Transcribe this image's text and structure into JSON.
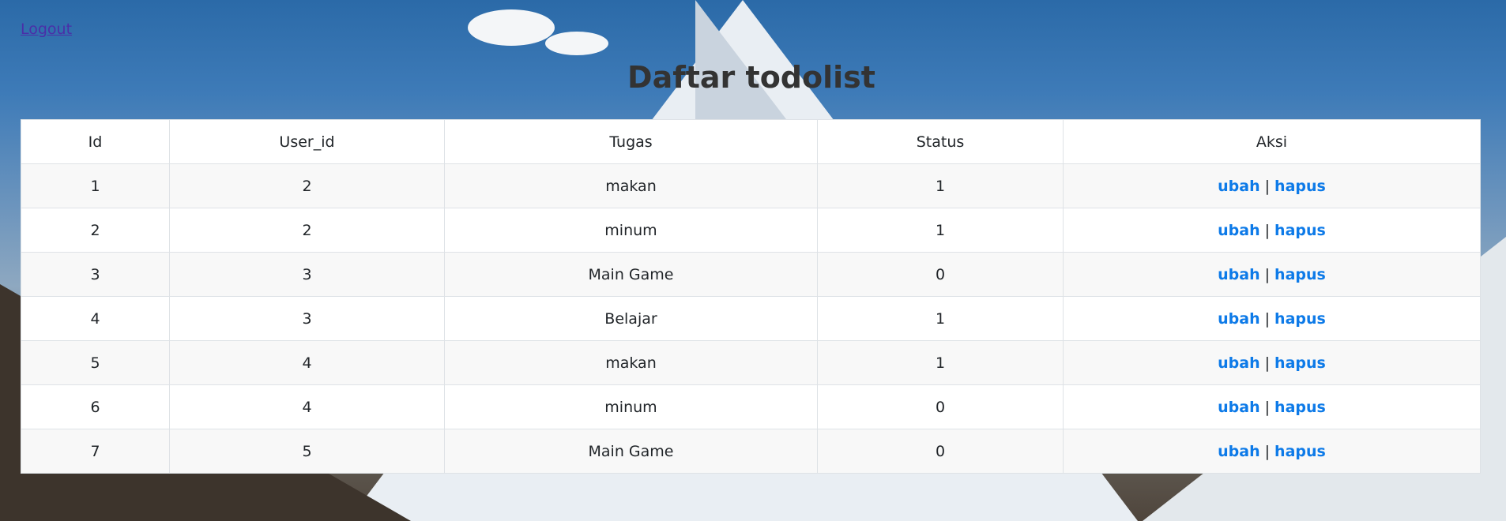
{
  "nav": {
    "logout_label": "Logout"
  },
  "page": {
    "title": "Daftar todolist"
  },
  "table": {
    "headers": [
      "Id",
      "User_id",
      "Tugas",
      "Status",
      "Aksi"
    ],
    "rows": [
      {
        "id": "1",
        "user_id": "2",
        "tugas": "makan",
        "status": "1"
      },
      {
        "id": "2",
        "user_id": "2",
        "tugas": "minum",
        "status": "1"
      },
      {
        "id": "3",
        "user_id": "3",
        "tugas": "Main Game",
        "status": "0"
      },
      {
        "id": "4",
        "user_id": "3",
        "tugas": "Belajar",
        "status": "1"
      },
      {
        "id": "5",
        "user_id": "4",
        "tugas": "makan",
        "status": "1"
      },
      {
        "id": "6",
        "user_id": "4",
        "tugas": "minum",
        "status": "0"
      },
      {
        "id": "7",
        "user_id": "5",
        "tugas": "Main Game",
        "status": "0"
      }
    ],
    "actions": {
      "edit_label": "ubah",
      "separator": "|",
      "delete_label": "hapus"
    }
  },
  "colors": {
    "link": "#0d7ae8",
    "logout_link": "#4a2fa8",
    "title": "#333333"
  }
}
